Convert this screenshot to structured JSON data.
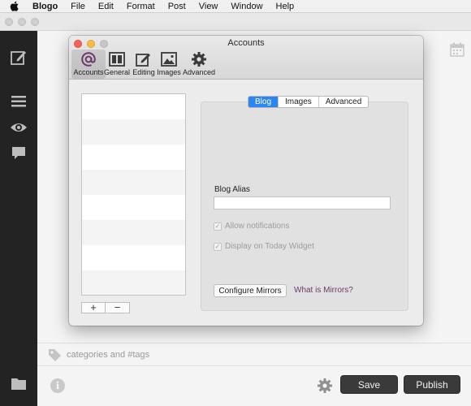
{
  "menubar": {
    "apple_icon": "apple-logo-icon",
    "app_name": "Blogo",
    "items": [
      "File",
      "Edit",
      "Format",
      "Post",
      "View",
      "Window",
      "Help"
    ]
  },
  "editor": {
    "tags_placeholder": "categories and #tags",
    "save_label": "Save",
    "publish_label": "Publish"
  },
  "dialog": {
    "title": "Accounts",
    "tabs": [
      {
        "label": "Accounts",
        "icon": "at-sign-icon",
        "selected": true
      },
      {
        "label": "General",
        "icon": "layout-icon",
        "selected": false
      },
      {
        "label": "Editing",
        "icon": "edit-icon",
        "selected": false
      },
      {
        "label": "Images",
        "icon": "image-icon",
        "selected": false
      },
      {
        "label": "Advanced",
        "icon": "gear-icon",
        "selected": false
      }
    ],
    "list_add": "+",
    "list_remove": "−",
    "segments": [
      {
        "label": "Blog",
        "selected": true
      },
      {
        "label": "Images",
        "selected": false
      },
      {
        "label": "Advanced",
        "selected": false
      }
    ],
    "alias_label": "Blog Alias",
    "alias_value": "",
    "checkboxes": [
      {
        "label": "Allow notifications",
        "checked": true,
        "enabled": false
      },
      {
        "label": "Display on Today Widget",
        "checked": true,
        "enabled": false
      }
    ],
    "configure_button": "Configure Mirrors",
    "mirrors_link": "What is Mirrors?"
  },
  "colors": {
    "sidebar": "#232323",
    "accent": "#2a86f0",
    "link": "#6a3a6a",
    "close": "#fc605c",
    "minimize": "#fdbc40"
  }
}
